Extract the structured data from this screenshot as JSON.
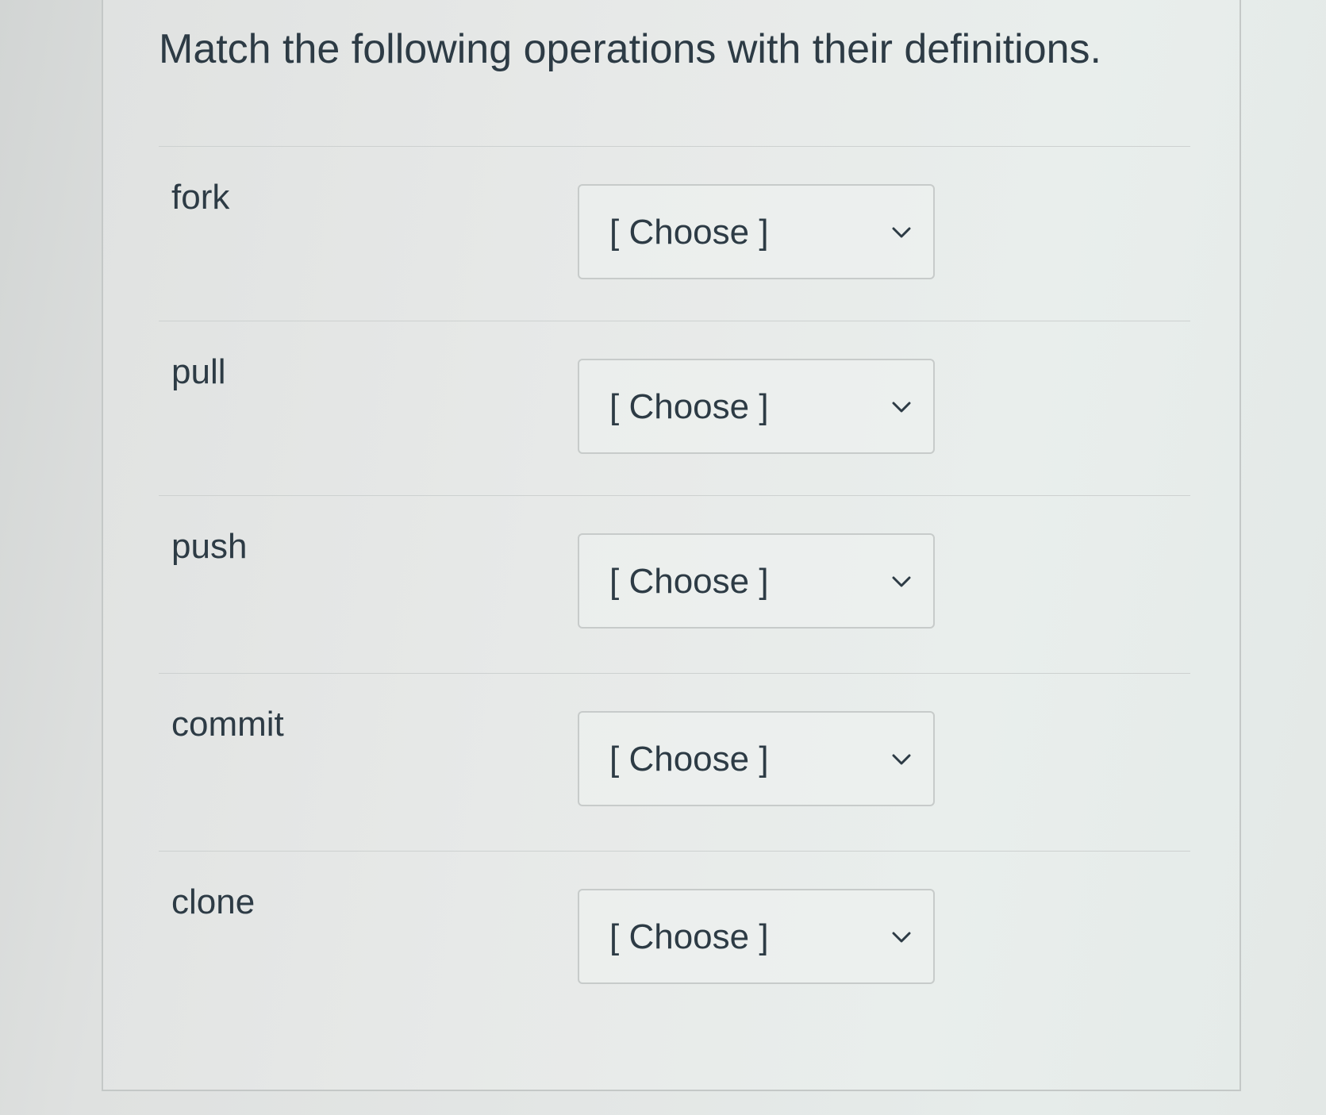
{
  "question": {
    "text": "Match the following operations with their definitions."
  },
  "matches": [
    {
      "term": "fork",
      "selected": "[ Choose ]",
      "chevron_icon": "chevron-down-icon"
    },
    {
      "term": "pull",
      "selected": "[ Choose ]",
      "chevron_icon": "chevron-down-icon"
    },
    {
      "term": "push",
      "selected": "[ Choose ]",
      "chevron_icon": "chevron-down-icon"
    },
    {
      "term": "commit",
      "selected": "[ Choose ]",
      "chevron_icon": "chevron-down-icon"
    },
    {
      "term": "clone",
      "selected": "[ Choose ]",
      "chevron_icon": "chevron-down-icon"
    }
  ],
  "colors": {
    "text": "#2d3b45",
    "select_border": "#c7cbca",
    "divider": "#cdd1d0"
  }
}
